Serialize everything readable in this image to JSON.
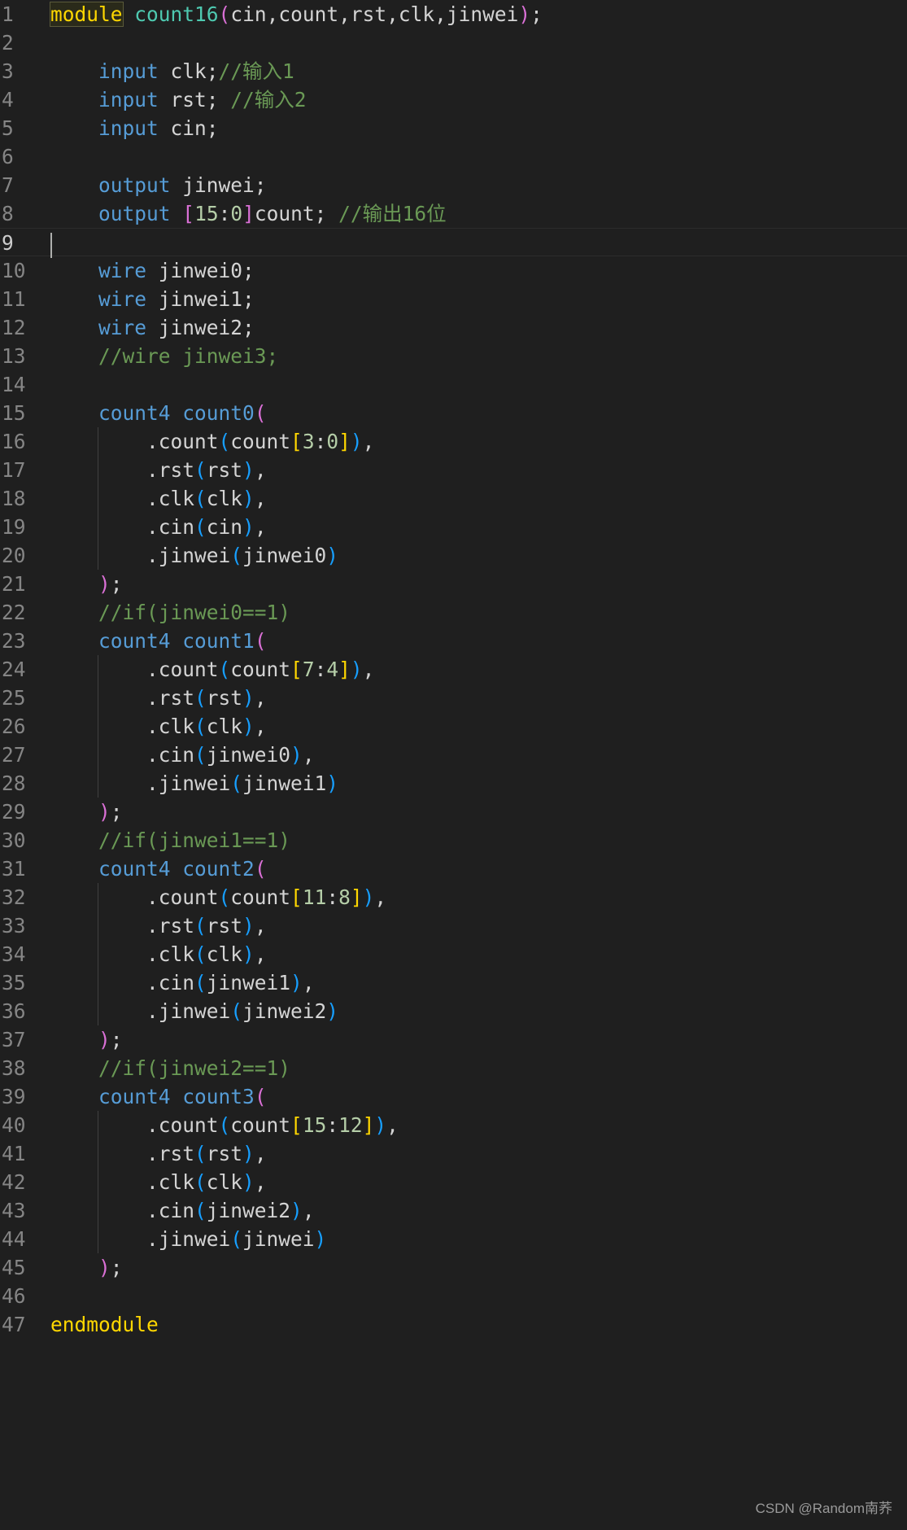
{
  "editor": {
    "language": "verilog",
    "active_line": 9,
    "colors": {
      "background": "#1f1f1f",
      "keyword_control": "#ffd700",
      "keyword": "#569cd6",
      "type_name": "#4ec9b0",
      "comment": "#6a9955",
      "number": "#b5cea8",
      "bracket_1": "#da70d6",
      "bracket_2": "#179fff",
      "bracket_3": "#ffd700"
    },
    "lines": [
      {
        "n": "1",
        "tokens": [
          [
            "module",
            "kw-control module-box"
          ],
          [
            " ",
            "text"
          ],
          [
            "count16",
            "fn"
          ],
          [
            "(",
            "b1"
          ],
          [
            "cin,count,rst,clk,jinwei",
            "text"
          ],
          [
            ")",
            "b1"
          ],
          [
            ";",
            "text"
          ]
        ]
      },
      {
        "n": "2",
        "tokens": []
      },
      {
        "n": "3",
        "tokens": [
          [
            "    ",
            "text"
          ],
          [
            "input",
            "kw"
          ],
          [
            " clk;",
            "text"
          ],
          [
            "//输入1",
            "comment"
          ]
        ]
      },
      {
        "n": "4",
        "tokens": [
          [
            "    ",
            "text"
          ],
          [
            "input",
            "kw"
          ],
          [
            " rst; ",
            "text"
          ],
          [
            "//输入2",
            "comment"
          ]
        ]
      },
      {
        "n": "5",
        "tokens": [
          [
            "    ",
            "text"
          ],
          [
            "input",
            "kw"
          ],
          [
            " cin;",
            "text"
          ]
        ]
      },
      {
        "n": "6",
        "tokens": []
      },
      {
        "n": "7",
        "tokens": [
          [
            "    ",
            "text"
          ],
          [
            "output",
            "kw"
          ],
          [
            " jinwei;",
            "text"
          ]
        ]
      },
      {
        "n": "8",
        "tokens": [
          [
            "    ",
            "text"
          ],
          [
            "output",
            "kw"
          ],
          [
            " ",
            "text"
          ],
          [
            "[",
            "b1"
          ],
          [
            "15",
            "num"
          ],
          [
            ":",
            "text"
          ],
          [
            "0",
            "num"
          ],
          [
            "]",
            "b1"
          ],
          [
            "count; ",
            "text"
          ],
          [
            "//输出16位",
            "comment"
          ]
        ]
      },
      {
        "n": "9",
        "tokens": []
      },
      {
        "n": "10",
        "tokens": [
          [
            "    ",
            "text"
          ],
          [
            "wire",
            "kw"
          ],
          [
            " jinwei0;",
            "text"
          ]
        ]
      },
      {
        "n": "11",
        "tokens": [
          [
            "    ",
            "text"
          ],
          [
            "wire",
            "kw"
          ],
          [
            " jinwei1;",
            "text"
          ]
        ]
      },
      {
        "n": "12",
        "tokens": [
          [
            "    ",
            "text"
          ],
          [
            "wire",
            "kw"
          ],
          [
            " jinwei2;",
            "text"
          ]
        ]
      },
      {
        "n": "13",
        "tokens": [
          [
            "    ",
            "text"
          ],
          [
            "//wire jinwei3;",
            "comment"
          ]
        ]
      },
      {
        "n": "14",
        "tokens": []
      },
      {
        "n": "15",
        "tokens": [
          [
            "    ",
            "text"
          ],
          [
            "count4",
            "kw"
          ],
          [
            " ",
            "text"
          ],
          [
            "count0",
            "kw"
          ],
          [
            "(",
            "b1"
          ]
        ]
      },
      {
        "n": "16",
        "tokens": [
          [
            "        .count",
            "text"
          ],
          [
            "(",
            "b2"
          ],
          [
            "count",
            "text"
          ],
          [
            "[",
            "b3"
          ],
          [
            "3",
            "num"
          ],
          [
            ":",
            "text"
          ],
          [
            "0",
            "num"
          ],
          [
            "]",
            "b3"
          ],
          [
            ")",
            "b2"
          ],
          [
            ",",
            "text"
          ]
        ]
      },
      {
        "n": "17",
        "tokens": [
          [
            "        .rst",
            "text"
          ],
          [
            "(",
            "b2"
          ],
          [
            "rst",
            "text"
          ],
          [
            ")",
            "b2"
          ],
          [
            ",",
            "text"
          ]
        ]
      },
      {
        "n": "18",
        "tokens": [
          [
            "        .clk",
            "text"
          ],
          [
            "(",
            "b2"
          ],
          [
            "clk",
            "text"
          ],
          [
            ")",
            "b2"
          ],
          [
            ",",
            "text"
          ]
        ]
      },
      {
        "n": "19",
        "tokens": [
          [
            "        .cin",
            "text"
          ],
          [
            "(",
            "b2"
          ],
          [
            "cin",
            "text"
          ],
          [
            ")",
            "b2"
          ],
          [
            ",",
            "text"
          ]
        ]
      },
      {
        "n": "20",
        "tokens": [
          [
            "        .jinwei",
            "text"
          ],
          [
            "(",
            "b2"
          ],
          [
            "jinwei0",
            "text"
          ],
          [
            ")",
            "b2"
          ]
        ]
      },
      {
        "n": "21",
        "tokens": [
          [
            "    ",
            "text"
          ],
          [
            ")",
            "b1"
          ],
          [
            ";",
            "text"
          ]
        ]
      },
      {
        "n": "22",
        "tokens": [
          [
            "    ",
            "text"
          ],
          [
            "//if(jinwei0==1)",
            "comment"
          ]
        ]
      },
      {
        "n": "23",
        "tokens": [
          [
            "    ",
            "text"
          ],
          [
            "count4",
            "kw"
          ],
          [
            " ",
            "text"
          ],
          [
            "count1",
            "kw"
          ],
          [
            "(",
            "b1"
          ]
        ]
      },
      {
        "n": "24",
        "tokens": [
          [
            "        .count",
            "text"
          ],
          [
            "(",
            "b2"
          ],
          [
            "count",
            "text"
          ],
          [
            "[",
            "b3"
          ],
          [
            "7",
            "num"
          ],
          [
            ":",
            "text"
          ],
          [
            "4",
            "num"
          ],
          [
            "]",
            "b3"
          ],
          [
            ")",
            "b2"
          ],
          [
            ",",
            "text"
          ]
        ]
      },
      {
        "n": "25",
        "tokens": [
          [
            "        .rst",
            "text"
          ],
          [
            "(",
            "b2"
          ],
          [
            "rst",
            "text"
          ],
          [
            ")",
            "b2"
          ],
          [
            ",",
            "text"
          ]
        ]
      },
      {
        "n": "26",
        "tokens": [
          [
            "        .clk",
            "text"
          ],
          [
            "(",
            "b2"
          ],
          [
            "clk",
            "text"
          ],
          [
            ")",
            "b2"
          ],
          [
            ",",
            "text"
          ]
        ]
      },
      {
        "n": "27",
        "tokens": [
          [
            "        .cin",
            "text"
          ],
          [
            "(",
            "b2"
          ],
          [
            "jinwei0",
            "text"
          ],
          [
            ")",
            "b2"
          ],
          [
            ",",
            "text"
          ]
        ]
      },
      {
        "n": "28",
        "tokens": [
          [
            "        .jinwei",
            "text"
          ],
          [
            "(",
            "b2"
          ],
          [
            "jinwei1",
            "text"
          ],
          [
            ")",
            "b2"
          ]
        ]
      },
      {
        "n": "29",
        "tokens": [
          [
            "    ",
            "text"
          ],
          [
            ")",
            "b1"
          ],
          [
            ";",
            "text"
          ]
        ]
      },
      {
        "n": "30",
        "tokens": [
          [
            "    ",
            "text"
          ],
          [
            "//if(jinwei1==1)",
            "comment"
          ]
        ]
      },
      {
        "n": "31",
        "tokens": [
          [
            "    ",
            "text"
          ],
          [
            "count4",
            "kw"
          ],
          [
            " ",
            "text"
          ],
          [
            "count2",
            "kw"
          ],
          [
            "(",
            "b1"
          ]
        ]
      },
      {
        "n": "32",
        "tokens": [
          [
            "        .count",
            "text"
          ],
          [
            "(",
            "b2"
          ],
          [
            "count",
            "text"
          ],
          [
            "[",
            "b3"
          ],
          [
            "11",
            "num"
          ],
          [
            ":",
            "text"
          ],
          [
            "8",
            "num"
          ],
          [
            "]",
            "b3"
          ],
          [
            ")",
            "b2"
          ],
          [
            ",",
            "text"
          ]
        ]
      },
      {
        "n": "33",
        "tokens": [
          [
            "        .rst",
            "text"
          ],
          [
            "(",
            "b2"
          ],
          [
            "rst",
            "text"
          ],
          [
            ")",
            "b2"
          ],
          [
            ",",
            "text"
          ]
        ]
      },
      {
        "n": "34",
        "tokens": [
          [
            "        .clk",
            "text"
          ],
          [
            "(",
            "b2"
          ],
          [
            "clk",
            "text"
          ],
          [
            ")",
            "b2"
          ],
          [
            ",",
            "text"
          ]
        ]
      },
      {
        "n": "35",
        "tokens": [
          [
            "        .cin",
            "text"
          ],
          [
            "(",
            "b2"
          ],
          [
            "jinwei1",
            "text"
          ],
          [
            ")",
            "b2"
          ],
          [
            ",",
            "text"
          ]
        ]
      },
      {
        "n": "36",
        "tokens": [
          [
            "        .jinwei",
            "text"
          ],
          [
            "(",
            "b2"
          ],
          [
            "jinwei2",
            "text"
          ],
          [
            ")",
            "b2"
          ]
        ]
      },
      {
        "n": "37",
        "tokens": [
          [
            "    ",
            "text"
          ],
          [
            ")",
            "b1"
          ],
          [
            ";",
            "text"
          ]
        ]
      },
      {
        "n": "38",
        "tokens": [
          [
            "    ",
            "text"
          ],
          [
            "//if(jinwei2==1)",
            "comment"
          ]
        ]
      },
      {
        "n": "39",
        "tokens": [
          [
            "    ",
            "text"
          ],
          [
            "count4",
            "kw"
          ],
          [
            " ",
            "text"
          ],
          [
            "count3",
            "kw"
          ],
          [
            "(",
            "b1"
          ]
        ]
      },
      {
        "n": "40",
        "tokens": [
          [
            "        .count",
            "text"
          ],
          [
            "(",
            "b2"
          ],
          [
            "count",
            "text"
          ],
          [
            "[",
            "b3"
          ],
          [
            "15",
            "num"
          ],
          [
            ":",
            "text"
          ],
          [
            "12",
            "num"
          ],
          [
            "]",
            "b3"
          ],
          [
            ")",
            "b2"
          ],
          [
            ",",
            "text"
          ]
        ]
      },
      {
        "n": "41",
        "tokens": [
          [
            "        .rst",
            "text"
          ],
          [
            "(",
            "b2"
          ],
          [
            "rst",
            "text"
          ],
          [
            ")",
            "b2"
          ],
          [
            ",",
            "text"
          ]
        ]
      },
      {
        "n": "42",
        "tokens": [
          [
            "        .clk",
            "text"
          ],
          [
            "(",
            "b2"
          ],
          [
            "clk",
            "text"
          ],
          [
            ")",
            "b2"
          ],
          [
            ",",
            "text"
          ]
        ]
      },
      {
        "n": "43",
        "tokens": [
          [
            "        .cin",
            "text"
          ],
          [
            "(",
            "b2"
          ],
          [
            "jinwei2",
            "text"
          ],
          [
            ")",
            "b2"
          ],
          [
            ",",
            "text"
          ]
        ]
      },
      {
        "n": "44",
        "tokens": [
          [
            "        .jinwei",
            "text"
          ],
          [
            "(",
            "b2"
          ],
          [
            "jinwei",
            "text"
          ],
          [
            ")",
            "b2"
          ]
        ]
      },
      {
        "n": "45",
        "tokens": [
          [
            "    ",
            "text"
          ],
          [
            ")",
            "b1"
          ],
          [
            ";",
            "text"
          ]
        ]
      },
      {
        "n": "46",
        "tokens": []
      },
      {
        "n": "47",
        "tokens": [
          [
            "endmodule",
            "kw-control"
          ]
        ]
      }
    ]
  },
  "watermark": "CSDN @Random南荞"
}
